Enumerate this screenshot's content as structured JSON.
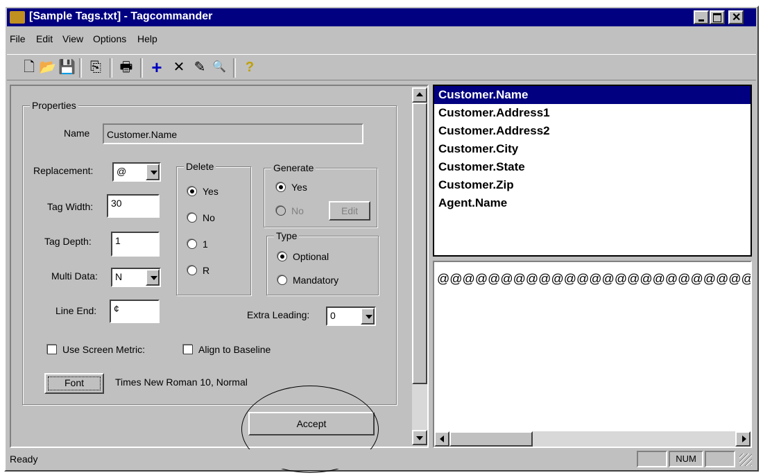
{
  "window": {
    "title": "[Sample Tags.txt] - Tagcommander"
  },
  "menu": [
    "File",
    "Edit",
    "View",
    "Options",
    "Help"
  ],
  "toolbar": {
    "icons": [
      "new-icon",
      "open-icon",
      "save-icon",
      "copy-icon",
      "print-icon",
      "add-icon",
      "delete-icon",
      "find-icon",
      "search-icon",
      "help-icon"
    ],
    "glyphs": [
      "🗋",
      "📂",
      "💾",
      "⎘",
      "🖶",
      "+",
      "✕",
      "✎",
      "🔍",
      "?"
    ]
  },
  "properties": {
    "group_title": "Properties",
    "name_label": "Name",
    "name_value": "Customer.Name",
    "replacement_label": "Replacement:",
    "replacement_value": "@",
    "tag_width_label": "Tag Width:",
    "tag_width_value": "30",
    "tag_depth_label": "Tag Depth:",
    "tag_depth_value": "1",
    "multi_data_label": "Multi Data:",
    "multi_data_value": "N",
    "line_end_label": "Line End:",
    "line_end_value": "¢",
    "delete": {
      "title": "Delete",
      "options": [
        "Yes",
        "No",
        "1",
        "R"
      ],
      "selected": "Yes"
    },
    "generate": {
      "title": "Generate",
      "options": [
        "Yes",
        "No"
      ],
      "selected": "Yes",
      "edit_label": "Edit"
    },
    "type": {
      "title": "Type",
      "options": [
        "Optional",
        "Mandatory"
      ],
      "selected": "Optional"
    },
    "extra_leading_label": "Extra Leading:",
    "extra_leading_value": "0",
    "use_screen_metric_label": "Use Screen Metric:",
    "align_baseline_label": "Align to Baseline",
    "font_button": "Font",
    "font_value": "Times New Roman 10, Normal",
    "accept_button": "Accept"
  },
  "tag_list": {
    "items": [
      "Customer.Name",
      "Customer.Address1",
      "Customer.Address2",
      "Customer.City",
      "Customer.State",
      "Customer.Zip",
      "Agent.Name"
    ],
    "selected_index": 0
  },
  "preview": {
    "text": "@@@@@@@@@@@@@@@@@@@@@@@@@@@@@@"
  },
  "status": {
    "text": "Ready",
    "num": "NUM"
  },
  "colors": {
    "titlebar": "#000080",
    "face": "#c0c0c0",
    "selection": "#000080"
  }
}
